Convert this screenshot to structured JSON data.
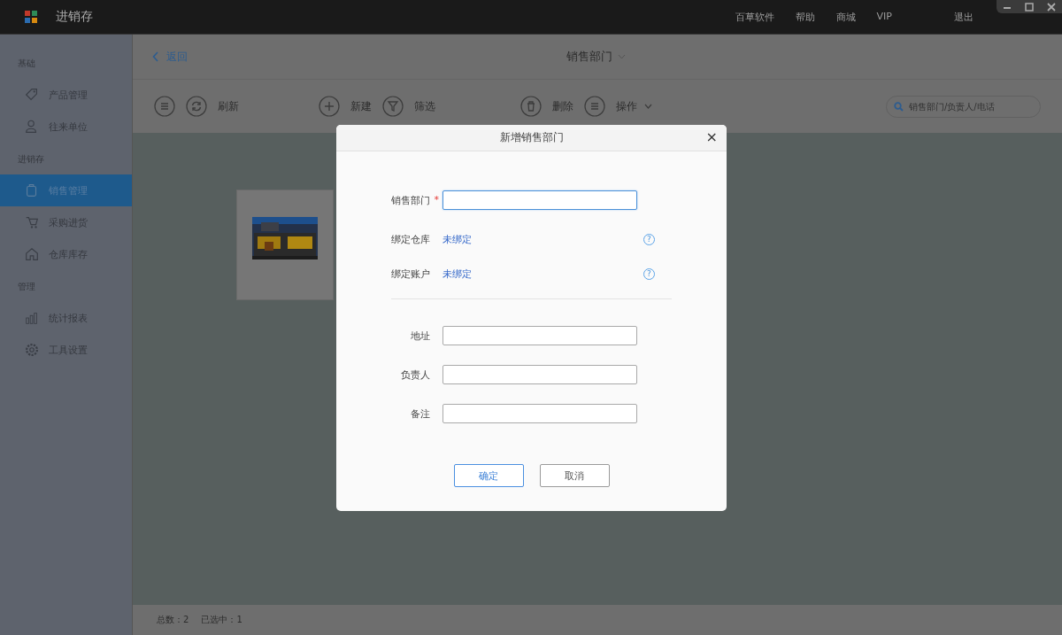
{
  "window": {
    "title": "进销存",
    "menu": [
      "百草软件",
      "帮助",
      "商城",
      "VIP",
      "退出"
    ]
  },
  "sidebar": {
    "sections": [
      {
        "label": "基础",
        "items": [
          {
            "label": "产品管理",
            "selected": false
          },
          {
            "label": "往来单位",
            "selected": false
          }
        ]
      },
      {
        "label": "进销存",
        "items": [
          {
            "label": "销售管理",
            "selected": true
          },
          {
            "label": "采购进货",
            "selected": false
          },
          {
            "label": "仓库库存",
            "selected": false
          }
        ]
      },
      {
        "label": "管理",
        "items": [
          {
            "label": "统计报表",
            "selected": false
          },
          {
            "label": "工具设置",
            "selected": false
          }
        ]
      }
    ]
  },
  "header": {
    "back": "返回",
    "title": "销售部门"
  },
  "toolbar": {
    "items": [
      {
        "label": "刷新",
        "dropdown": false
      },
      {
        "label": "新建",
        "dropdown": false
      },
      {
        "label": "筛选",
        "dropdown": false
      },
      {
        "label": "删除",
        "dropdown": false
      },
      {
        "label": "操作",
        "dropdown": true
      }
    ],
    "search": {
      "placeholder": "销售部门/负责人/电话"
    }
  },
  "status_bar": {
    "total_label": "总数：",
    "total": "2",
    "selected_label": "已选中：",
    "selected": "1"
  },
  "dialog": {
    "title": "新增销售部门",
    "close": "×",
    "fields": [
      {
        "kind": "input",
        "label": "销售部门",
        "required_mark": "*",
        "focused": true
      },
      {
        "kind": "link",
        "label": "绑定仓库",
        "value": "未绑定",
        "help": "?"
      },
      {
        "kind": "link",
        "label": "绑定账户",
        "value": "未绑定",
        "help": "?"
      },
      {
        "kind": "divider"
      },
      {
        "kind": "input",
        "label": "地址",
        "focused": false
      },
      {
        "kind": "input",
        "label": "负责人",
        "focused": false
      },
      {
        "kind": "input",
        "label": "备注",
        "focused": false
      }
    ],
    "buttons": [
      {
        "label": "确定",
        "primary": true
      },
      {
        "label": "取消",
        "primary": false
      }
    ]
  }
}
